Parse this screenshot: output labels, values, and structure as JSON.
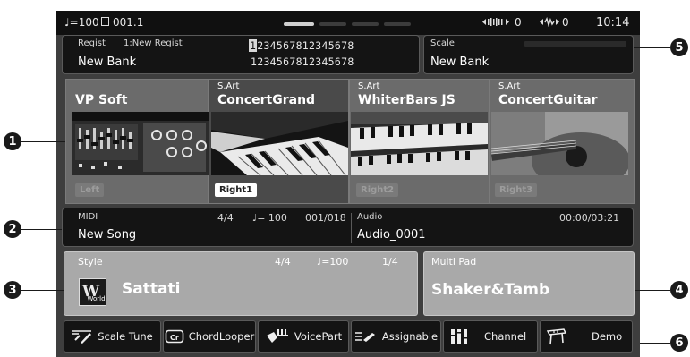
{
  "status_bar": {
    "tempo": "♩=100",
    "bar_counter": "001.1",
    "midi_in": "0",
    "audio_in": "0",
    "time": "10:14"
  },
  "registration": {
    "label": "Regist",
    "current_name": "1:New Regist",
    "bank": "New Bank",
    "row1_first": "1",
    "row1_rest": "234567812345678",
    "row2": "1234567812345678"
  },
  "scale": {
    "label": "Scale",
    "bank": "New Bank"
  },
  "voices": [
    {
      "prefix": "",
      "name": "VP Soft",
      "part": "Left",
      "active": false
    },
    {
      "prefix": "S.Art",
      "name": "ConcertGrand",
      "part": "Right1",
      "active": true
    },
    {
      "prefix": "S.Art",
      "name": "WhiterBars JS",
      "part": "Right2",
      "active": false
    },
    {
      "prefix": "S.Art",
      "name": "ConcertGuitar",
      "part": "Right3",
      "active": false
    }
  ],
  "song": {
    "midi_label": "MIDI",
    "time_sig": "4/4",
    "tempo": "♩= 100",
    "position": "001/018",
    "name": "New Song",
    "audio_label": "Audio",
    "audio_time": "00:00/03:21",
    "audio_name": "Audio_0001"
  },
  "style": {
    "label": "Style",
    "time_sig": "4/4",
    "tempo": "♩=100",
    "measure": "1/4",
    "category_icon": "World",
    "name": "Sattati"
  },
  "multipad": {
    "label": "Multi Pad",
    "name": "Shaker&Tamb"
  },
  "buttons": [
    {
      "label": "Scale Tune",
      "icon": "scale-tune-icon"
    },
    {
      "label": "ChordLooper",
      "icon": "chord-looper-icon"
    },
    {
      "label": "VoicePart",
      "icon": "voice-part-icon"
    },
    {
      "label": "Assignable",
      "icon": "assignable-icon"
    },
    {
      "label": "Channel",
      "icon": "channel-icon"
    },
    {
      "label": "Demo",
      "icon": "demo-icon"
    }
  ],
  "callouts": [
    "1",
    "2",
    "3",
    "4",
    "5",
    "6"
  ]
}
